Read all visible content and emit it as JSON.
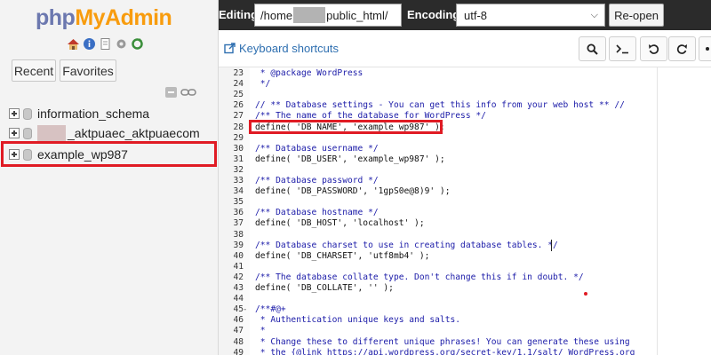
{
  "sidebar": {
    "logo_php": "php",
    "logo_myadmin": "MyAdmin",
    "icons": [
      "home-icon",
      "info-icon",
      "docs-icon",
      "settings-icon",
      "reload-icon"
    ],
    "recent_label": "Recent",
    "favorites_label": "Favorites",
    "databases": [
      {
        "name": "information_schema"
      },
      {
        "name": "_aktpuaec_aktpuaecom"
      },
      {
        "name": "example_wp987"
      }
    ]
  },
  "header": {
    "editing_label": "Editing:",
    "path_prefix": "/home",
    "path_suffix": "public_html/",
    "encoding_label": "Encoding:",
    "encoding_value": "utf-8",
    "reopen_label": "Re-open"
  },
  "toolbar": {
    "shortcuts_label": "Keyboard shortcuts"
  },
  "editor": {
    "lines": [
      {
        "n": "23",
        "text": " * @package WordPress",
        "kind": "comment"
      },
      {
        "n": "24",
        "text": " */",
        "kind": "comment"
      },
      {
        "n": "25",
        "text": "",
        "kind": "code"
      },
      {
        "n": "26",
        "text": "// ** Database settings - You can get this info from your web host ** //",
        "kind": "comment"
      },
      {
        "n": "27",
        "text": "/** The name of the database for WordPress */",
        "kind": "comment"
      },
      {
        "n": "28",
        "text": "define( 'DB_NAME', 'example_wp987' );",
        "kind": "code"
      },
      {
        "n": "29",
        "text": "",
        "kind": "code"
      },
      {
        "n": "30",
        "text": "/** Database username */",
        "kind": "comment"
      },
      {
        "n": "31",
        "text": "define( 'DB_USER', 'example_wp987' );",
        "kind": "code"
      },
      {
        "n": "32",
        "text": "",
        "kind": "code"
      },
      {
        "n": "33",
        "text": "/** Database password */",
        "kind": "comment"
      },
      {
        "n": "34",
        "text": "define( 'DB_PASSWORD', '1gpS0e@8)9' );",
        "kind": "code"
      },
      {
        "n": "35",
        "text": "",
        "kind": "code"
      },
      {
        "n": "36",
        "text": "/** Database hostname */",
        "kind": "comment"
      },
      {
        "n": "37",
        "text": "define( 'DB_HOST', 'localhost' );",
        "kind": "code"
      },
      {
        "n": "38",
        "text": "",
        "kind": "code"
      },
      {
        "n": "39",
        "text": "/** Database charset to use in creating database tables. */",
        "kind": "comment"
      },
      {
        "n": "40",
        "text": "define( 'DB_CHARSET', 'utf8mb4' );",
        "kind": "code"
      },
      {
        "n": "41",
        "text": "",
        "kind": "code"
      },
      {
        "n": "42",
        "text": "/** The database collate type. Don't change this if in doubt. */",
        "kind": "comment"
      },
      {
        "n": "43",
        "text": "define( 'DB_COLLATE', '' );",
        "kind": "code"
      },
      {
        "n": "44",
        "text": "",
        "kind": "code"
      },
      {
        "n": "45",
        "text": "/**#@+",
        "kind": "comment",
        "fold": "-"
      },
      {
        "n": "46",
        "text": " * Authentication unique keys and salts.",
        "kind": "comment"
      },
      {
        "n": "47",
        "text": " *",
        "kind": "comment"
      },
      {
        "n": "48",
        "text": " * Change these to different unique phrases! You can generate these using",
        "kind": "comment"
      },
      {
        "n": "49",
        "text": " * the {@link https://api.wordpress.org/secret-key/1.1/salt/ WordPress.org",
        "kind": "comment"
      }
    ]
  },
  "colors": {
    "highlight": "#e01b24",
    "comment": "#1b1ba8",
    "header_bg": "#2b2b2b",
    "link": "#2e6fb0"
  }
}
